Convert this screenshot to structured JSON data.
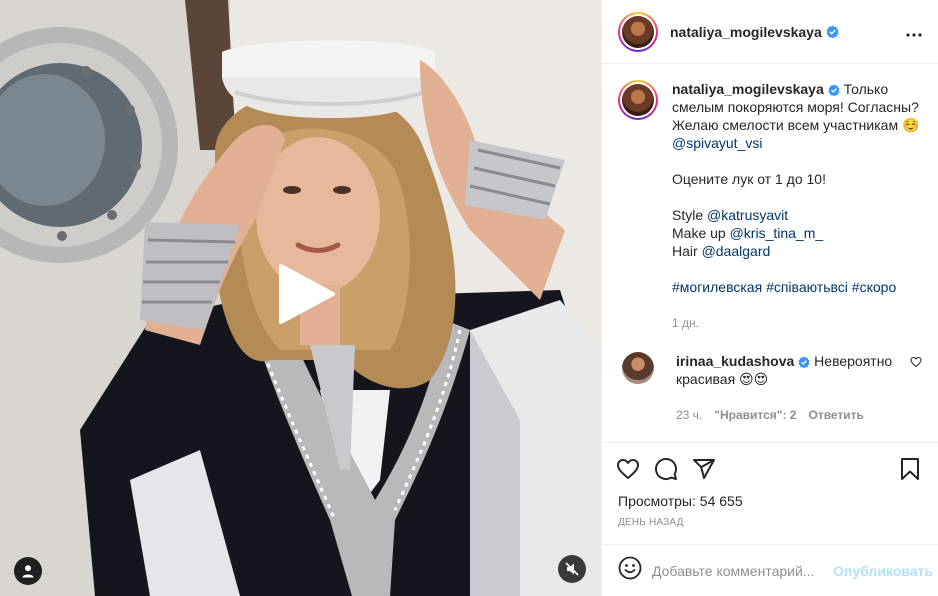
{
  "post": {
    "author": {
      "username": "nataliya_mogilevskaya",
      "verified": true
    },
    "caption": {
      "text_part1": " Только смелым покоряются моря! Согласны? Желаю смелости всем участникам ☺️ ",
      "mention1": "@spivayut_vsi",
      "line2": "Оцените лук от 1 до 10!",
      "style_label": "Style ",
      "style_mention": "@katrusyavit",
      "makeup_label": "Make up ",
      "makeup_mention": "@kris_tina_m_",
      "hair_label": "Hair ",
      "hair_mention": "@daalgard",
      "hashtag1": "#могилевская",
      "hashtag2": "#співаютьвсі",
      "hashtag3": "#скоро",
      "time": "1 дн."
    },
    "comments": [
      {
        "username": "irinaa_kudashova",
        "verified": true,
        "text": " Невероятно красивая 😍😍",
        "time": "23 ч.",
        "likes_label": "\"Нравится\": 2",
        "reply_label": "Ответить"
      }
    ],
    "views_label": "Просмотры:",
    "views_count": "54 655",
    "date_label": "День назад",
    "comment_input": {
      "placeholder": "Добавьте комментарий...",
      "value": ""
    },
    "publish_label": "Опубликовать"
  },
  "icons": {
    "more": "more-icon",
    "like": "heart-icon",
    "comment": "comment-icon",
    "share": "share-icon",
    "save": "bookmark-icon",
    "emoji": "emoji-icon",
    "play": "play-icon",
    "tag": "user-tag-icon",
    "mute": "muted-speaker-icon"
  },
  "colors": {
    "verified": "#3897f0",
    "link": "#00376b",
    "publish_disabled": "#b2dffc",
    "secondary_text": "#8e8e8e"
  }
}
